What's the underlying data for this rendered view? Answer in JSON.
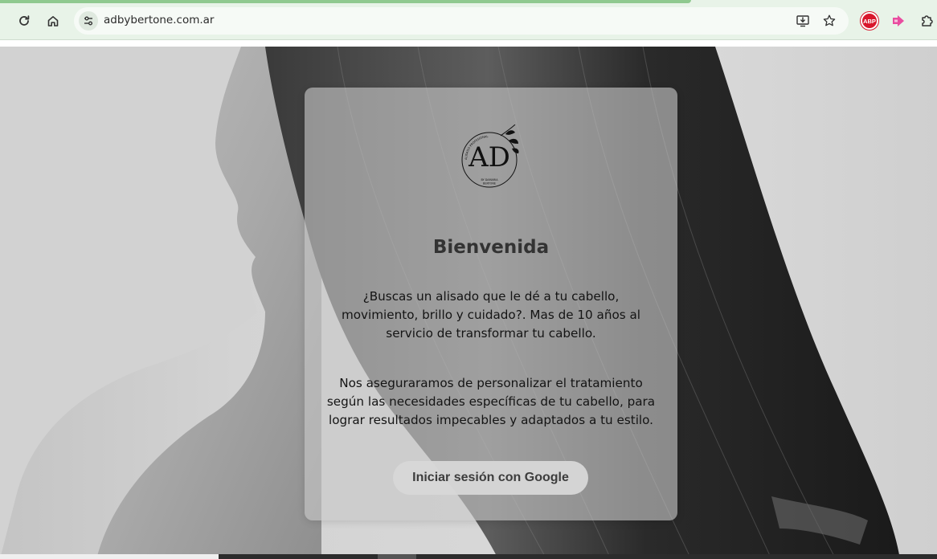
{
  "browser": {
    "url": "adbybertone.com.ar",
    "extensions": {
      "adblock_label": "ABP"
    },
    "icons": {
      "reload": "reload-icon",
      "home": "home-icon",
      "site_info": "tune-icon",
      "install": "install-app-icon",
      "bookmark": "star-icon",
      "adblock": "adblock-plus-icon",
      "pink_ext": "pink-arrow-extension-icon",
      "extensions": "puzzle-icon"
    },
    "colors": {
      "toolbar": "#e8f3e8",
      "tab_accent": "#8fc98f",
      "abp": "#d8172c"
    }
  },
  "page": {
    "logo": {
      "monogram": "AD",
      "top_arc": "ALISADO PROFESIONAL",
      "bottom_line1": "BY DAMARIA",
      "bottom_line2": "BERTONE"
    },
    "title": "Bienvenida",
    "paragraph1": "¿Buscas un alisado que le dé a tu cabello, movimiento, brillo y cuidado?. Mas de 10 años al servicio de transformar tu cabello.",
    "paragraph2": "Nos aseguraramos de personalizar el tratamiento según las necesidades específicas de tu cabello, para lograr resultados impecables y adaptados a tu estilo.",
    "login_button": "Iniciar sesión con Google"
  }
}
